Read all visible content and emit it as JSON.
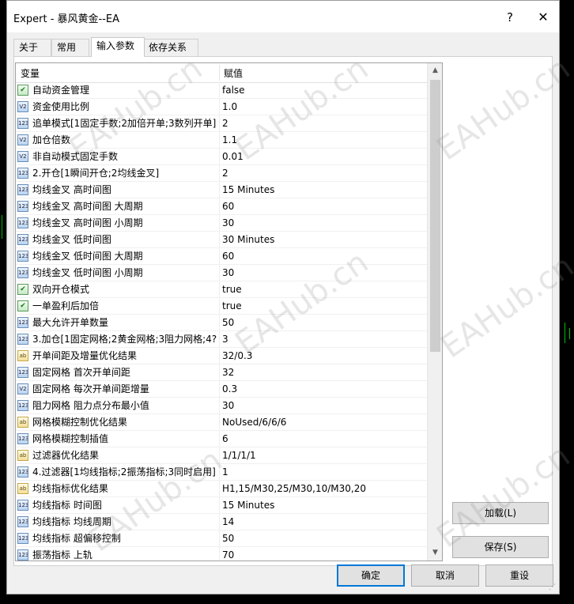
{
  "window": {
    "title": "Expert - 暴风黄金--EA",
    "help_label": "?",
    "close_label": "✕"
  },
  "tabs": [
    "关于",
    "常用",
    "输入参数",
    "依存关系"
  ],
  "active_tab": 2,
  "table": {
    "col_variable": "变量",
    "col_value": "赋值",
    "rows": [
      {
        "icon": "bool",
        "name": "自动资金管理",
        "value": "false"
      },
      {
        "icon": "double",
        "name": "资金使用比例",
        "value": "1.0"
      },
      {
        "icon": "int",
        "name": "追单模式[1固定手数;2加倍开单;3数列开单]",
        "value": "2"
      },
      {
        "icon": "double",
        "name": "加仓倍数",
        "value": "1.1"
      },
      {
        "icon": "double",
        "name": "非自动模式固定手数",
        "value": "0.01"
      },
      {
        "icon": "int",
        "name": "2.开仓[1瞬间开仓;2均线金叉]",
        "value": "2"
      },
      {
        "icon": "int",
        "name": "均线金叉 高时间图",
        "value": "15 Minutes"
      },
      {
        "icon": "int",
        "name": "均线金叉 高时间图 大周期",
        "value": "60"
      },
      {
        "icon": "int",
        "name": "均线金叉 高时间图 小周期",
        "value": "30"
      },
      {
        "icon": "int",
        "name": "均线金叉 低时间图",
        "value": "30 Minutes"
      },
      {
        "icon": "int",
        "name": "均线金叉 低时间图 大周期",
        "value": "60"
      },
      {
        "icon": "int",
        "name": "均线金叉 低时间图 小周期",
        "value": "30"
      },
      {
        "icon": "bool",
        "name": "双向开仓模式",
        "value": "true"
      },
      {
        "icon": "bool",
        "name": "一单盈利后加倍",
        "value": "true"
      },
      {
        "icon": "int",
        "name": "最大允许开单数量",
        "value": "50"
      },
      {
        "icon": "int",
        "name": "3.加仓[1固定网格;2黄金网格;3阻力网格;4?...",
        "value": "3"
      },
      {
        "icon": "string",
        "name": "开单间距及增量优化结果",
        "value": "32/0.3"
      },
      {
        "icon": "int",
        "name": "固定网格 首次开单间距",
        "value": "32"
      },
      {
        "icon": "double",
        "name": "固定网格 每次开单间距增量",
        "value": "0.3"
      },
      {
        "icon": "int",
        "name": "阻力网格 阻力点分布最小值",
        "value": "30"
      },
      {
        "icon": "string",
        "name": "网格模糊控制优化结果",
        "value": "NoUsed/6/6/6"
      },
      {
        "icon": "int",
        "name": "网格模糊控制插值",
        "value": "6"
      },
      {
        "icon": "string",
        "name": "过滤器优化结果",
        "value": "1/1/1/1"
      },
      {
        "icon": "int",
        "name": "4.过滤器[1均线指标;2振荡指标;3同时启用]",
        "value": "1"
      },
      {
        "icon": "string",
        "name": "均线指标优化结果",
        "value": "H1,15/M30,25/M30,10/M30,20"
      },
      {
        "icon": "int",
        "name": "均线指标 时间图",
        "value": "15 Minutes"
      },
      {
        "icon": "int",
        "name": "均线指标 均线周期",
        "value": "14"
      },
      {
        "icon": "int",
        "name": "均线指标 超偏移控制",
        "value": "50"
      },
      {
        "icon": "int",
        "name": "振荡指标 上轨",
        "value": "70"
      }
    ]
  },
  "icons": {
    "bool": "✔",
    "double": "V2",
    "int": "123",
    "string": "ab"
  },
  "buttons": {
    "load": "加载(L)",
    "save": "保存(S)",
    "ok": "确定",
    "cancel": "取消",
    "reset": "重设"
  },
  "watermark": "EAHub.cn",
  "colors": {
    "accent": "#0078d7",
    "chart_line": "#00c000"
  }
}
